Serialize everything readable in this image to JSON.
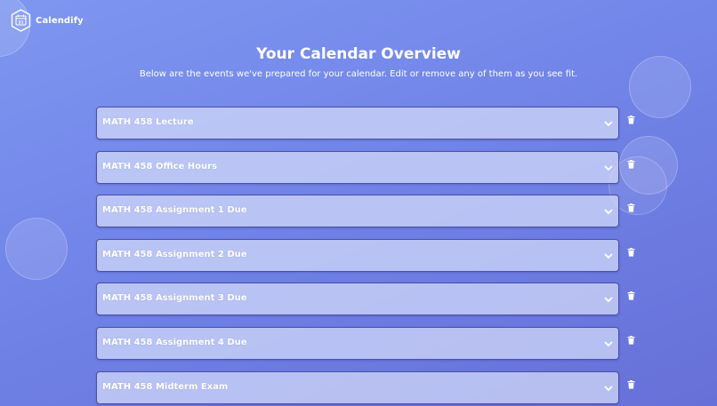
{
  "brand": {
    "name": "Calendify",
    "icon": "calendar-icon",
    "icon_text": "31"
  },
  "header": {
    "title": "Your Calendar Overview",
    "subtitle": "Below are the events we've prepared for your calendar. Edit or remove any of them as you see fit."
  },
  "events": [
    {
      "label": "MATH 458 Lecture"
    },
    {
      "label": "MATH 458 Office Hours"
    },
    {
      "label": "MATH 458 Assignment 1 Due"
    },
    {
      "label": "MATH 458 Assignment 2 Due"
    },
    {
      "label": "MATH 458 Assignment 3 Due"
    },
    {
      "label": "MATH 458 Assignment 4 Due"
    },
    {
      "label": "MATH 458 Midterm Exam"
    }
  ],
  "icons": {
    "expand": "chevron-down-icon",
    "delete": "trash-icon"
  },
  "colors": {
    "background_start": "#7e97f0",
    "background_end": "#6770d8",
    "card_border": "#4a50a8",
    "text": "#ffffff"
  }
}
